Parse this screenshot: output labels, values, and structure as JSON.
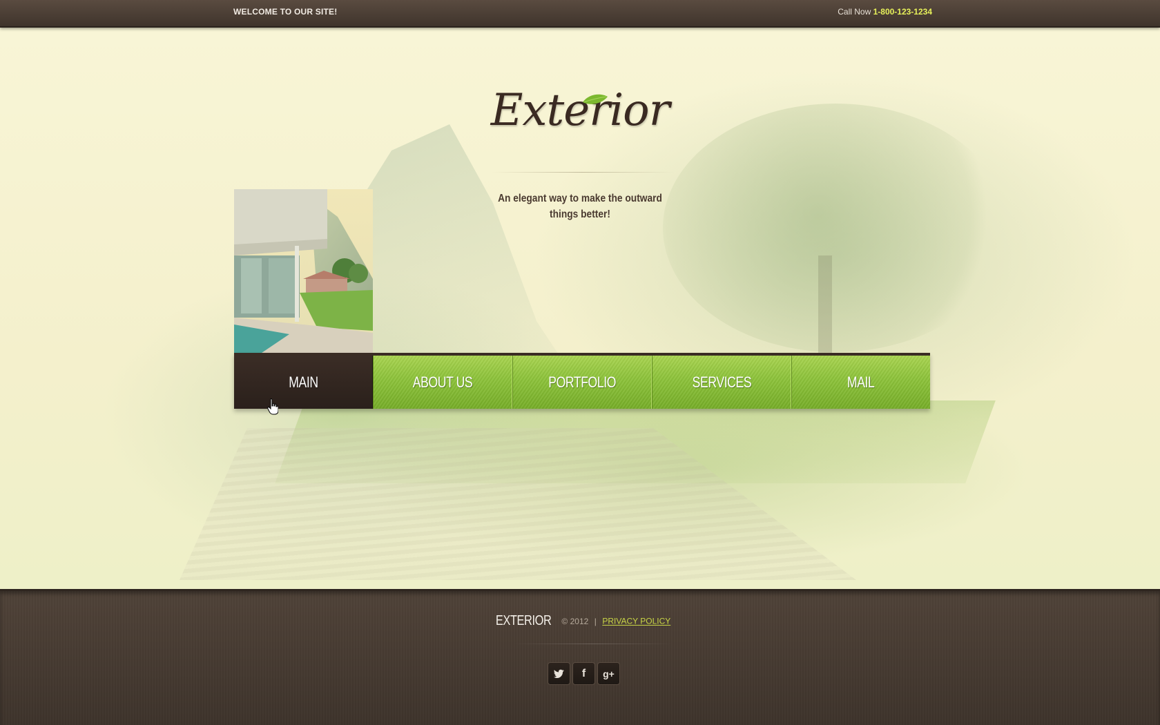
{
  "topbar": {
    "welcome": "WELCOME TO OUR SITE!",
    "call_label": "Call Now ",
    "phone": "1-800-123-1234"
  },
  "hero": {
    "logo_text": "Exterior",
    "tagline_line1": "An elegant way to make the outward",
    "tagline_line2": "things better!"
  },
  "nav": {
    "items": [
      {
        "label": "MAIN",
        "active": true
      },
      {
        "label": "ABOUT US",
        "active": false
      },
      {
        "label": "PORTFOLIO",
        "active": false
      },
      {
        "label": "SERVICES",
        "active": false
      },
      {
        "label": "MAIL",
        "active": false
      }
    ]
  },
  "footer": {
    "brand": "EXTERIOR",
    "copyright": "© 2012",
    "separator": "|",
    "privacy": "PRIVACY POLICY",
    "social": [
      {
        "icon": "twitter-icon",
        "glyph": "🐦"
      },
      {
        "icon": "facebook-icon",
        "glyph": "f"
      },
      {
        "icon": "google-plus-icon",
        "glyph": "g+"
      }
    ]
  },
  "colors": {
    "accent_green": "#8cc23a",
    "dark_brown": "#3a2c24",
    "phone_yellow": "#e7f15a",
    "privacy_link": "#c9d646"
  }
}
